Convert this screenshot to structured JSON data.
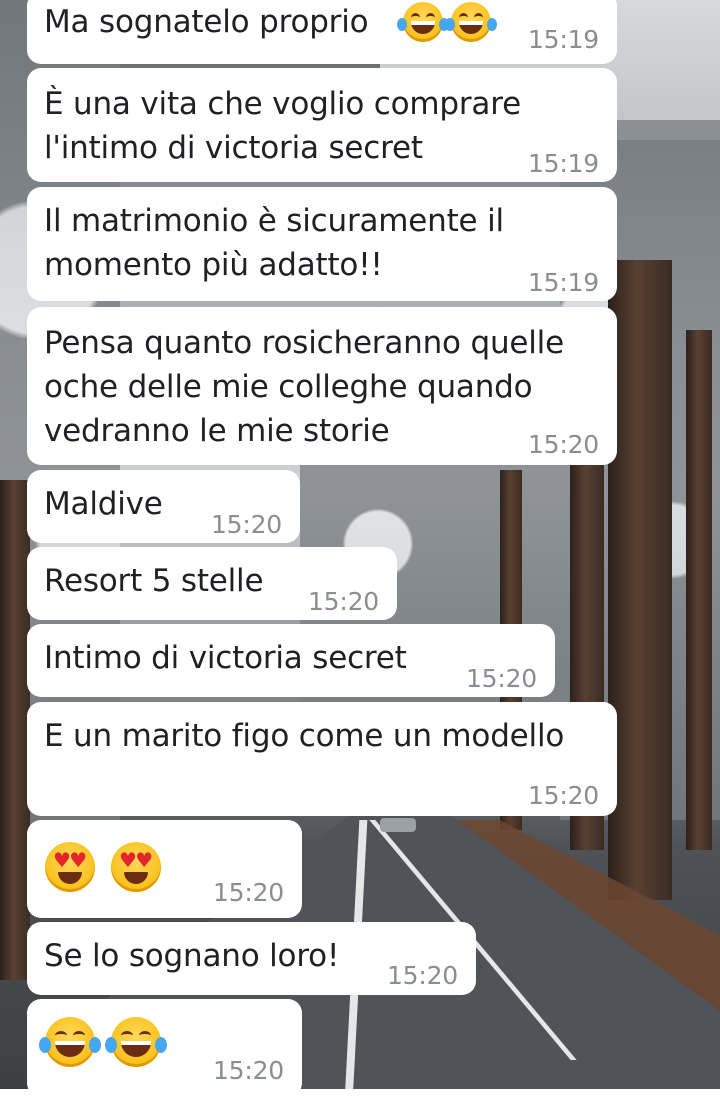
{
  "messages": [
    {
      "text": "Ma sognatelo proprio",
      "time": "15:19",
      "emoji": [
        "tears-of-joy",
        "tears-of-joy"
      ]
    },
    {
      "text": "È una vita che voglio comprare\nl'intimo di victoria secret",
      "time": "15:19"
    },
    {
      "text": "Il matrimonio è sicuramente il\nmomento più adatto!!",
      "time": "15:19"
    },
    {
      "text": "Pensa quanto rosicheranno quelle\noche delle mie colleghe quando\nvedranno le mie storie",
      "time": "15:20"
    },
    {
      "text": "Maldive",
      "time": "15:20"
    },
    {
      "text": "Resort 5 stelle",
      "time": "15:20"
    },
    {
      "text": "Intimo di victoria secret",
      "time": "15:20"
    },
    {
      "text": "E un marito figo come un modello",
      "time": "15:20"
    },
    {
      "text": "",
      "time": "15:20",
      "emoji": [
        "heart-eyes",
        "heart-eyes"
      ]
    },
    {
      "text": "Se lo sognano loro!",
      "time": "15:20"
    },
    {
      "text": "",
      "time": "15:20",
      "emoji": [
        "tears-of-joy",
        "tears-of-joy"
      ]
    }
  ],
  "colors": {
    "bubble": "#ffffff",
    "text": "#202124",
    "time": "#8a8d91"
  }
}
